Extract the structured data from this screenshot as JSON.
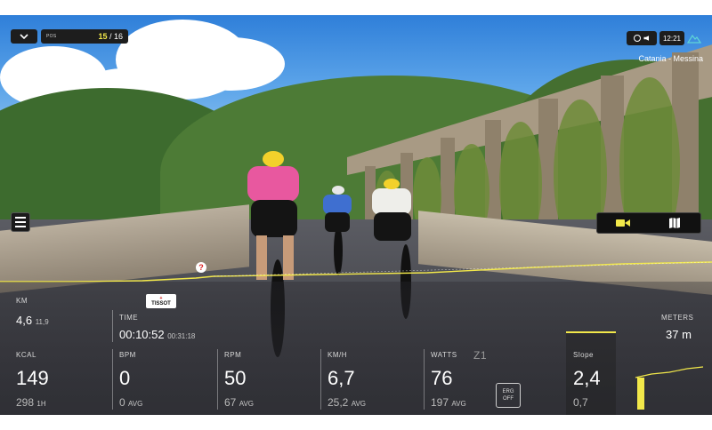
{
  "header": {
    "position_label": "POS",
    "position": "15",
    "position_total": "/ 16",
    "clock": "12:21",
    "route_name": "Catania - Messina"
  },
  "icons": {
    "collapse": "chevron-down-icon",
    "compass": "compass-icon",
    "speaker": "speaker-icon",
    "climb": "mountain-icon",
    "menu": "menu-icon",
    "camera": "video-camera-icon",
    "map": "map-icon",
    "marker": "question-marker-icon",
    "expand": "chevron-down-icon"
  },
  "colors": {
    "accent": "#f2e84a",
    "panel": "#1d1d1d"
  },
  "sponsor": {
    "line1": "TISSOT"
  },
  "metrics": {
    "km": {
      "label": "KM",
      "value": "4,6",
      "total": "11,9"
    },
    "time": {
      "label": "TIME",
      "value": "00:10:52",
      "total": "00:31:18"
    },
    "meters": {
      "label": "METERS",
      "value": "37 m"
    },
    "kcal": {
      "label": "KCAL",
      "value": "149",
      "sub_value": "298",
      "sub_unit": "1H"
    },
    "bpm": {
      "label": "BPM",
      "value": "0",
      "sub_value": "0",
      "sub_unit": "AVG"
    },
    "rpm": {
      "label": "RPM",
      "value": "50",
      "sub_value": "67",
      "sub_unit": "AVG"
    },
    "speed": {
      "label": "KM/H",
      "value": "6,7",
      "sub_value": "25,2",
      "sub_unit": "AVG"
    },
    "watts": {
      "label": "WATTS",
      "zone": "Z1",
      "value": "76",
      "sub_value": "197",
      "sub_unit": "AVG"
    },
    "erg": {
      "line1": "ERG",
      "line2": "OFF"
    },
    "slope": {
      "label": "Slope",
      "value": "2,4",
      "sub_value": "0,7"
    }
  }
}
